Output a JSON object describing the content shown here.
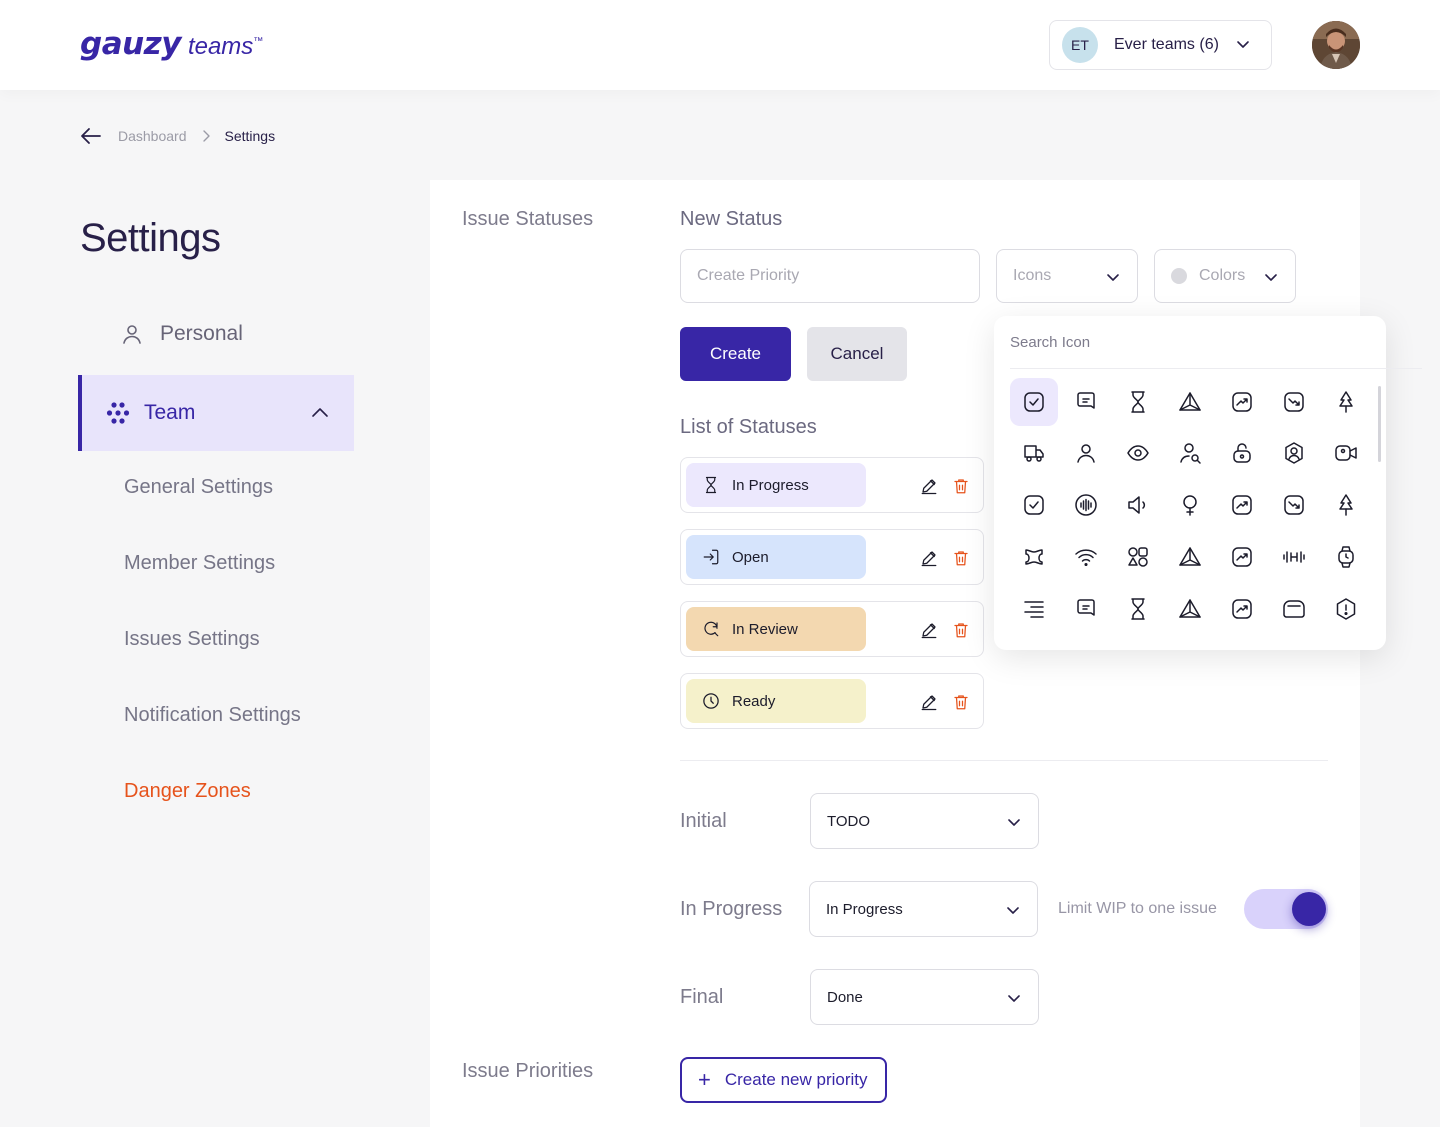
{
  "header": {
    "logo_brand": "gauzy",
    "logo_sub": "teams",
    "logo_tm": "™",
    "team_switcher": {
      "initials": "ET",
      "name": "Ever teams (6)"
    }
  },
  "breadcrumb": {
    "items": [
      "Dashboard",
      "Settings"
    ]
  },
  "sidebar": {
    "title": "Settings",
    "personal": "Personal",
    "team": "Team",
    "sub_items": [
      "General Settings",
      "Member Settings",
      "Issues Settings",
      "Notification Settings"
    ],
    "danger": "Danger Zones"
  },
  "issue_statuses": {
    "section_title": "Issue Statuses",
    "new_status_title": "New Status",
    "name_placeholder": "Create Priority",
    "icons_label": "Icons",
    "colors_label": "Colors",
    "create_button": "Create",
    "cancel_button": "Cancel",
    "list_title": "List of Statuses",
    "statuses": [
      {
        "label": "In Progress",
        "color": "#ece8fd",
        "icon": "hourglass-icon"
      },
      {
        "label": "Open",
        "color": "#d6e4fc",
        "icon": "login-icon"
      },
      {
        "label": "In Review",
        "color": "#f3d8b0",
        "icon": "search-refresh-icon"
      },
      {
        "label": "Ready",
        "color": "#f5f1cb",
        "icon": "clock-icon"
      }
    ]
  },
  "workflow": {
    "initial_label": "Initial",
    "initial_value": "TODO",
    "in_progress_label": "In Progress",
    "in_progress_value": "In Progress",
    "final_label": "Final",
    "final_value": "Done",
    "wip_label": "Limit WIP to one issue",
    "wip_enabled": true
  },
  "issue_priorities": {
    "section_title": "Issue Priorities",
    "create_button": "Create new priority"
  },
  "icon_picker": {
    "search_placeholder": "Search Icon",
    "selected_index": 0,
    "icons": [
      "task-square-icon",
      "message-square-icon",
      "hourglass-icon",
      "triangle-icon",
      "trend-up-icon",
      "trend-down-icon",
      "tree-icon",
      "truck-icon",
      "user-icon",
      "eye-icon",
      "user-search-icon",
      "unlock-icon",
      "user-hexagon-icon",
      "video-icon",
      "task-square-icon",
      "voice-circle-icon",
      "volume-icon",
      "woman-icon",
      "trend-up-icon",
      "trend-down-icon",
      "tree-icon",
      "weight-icon",
      "wifi-icon",
      "shapes-icon",
      "triangle-icon",
      "trend-up-icon",
      "dumbbell-icon",
      "watch-icon",
      "text-align-right-icon",
      "message-square-icon",
      "hourglass-icon",
      "triangle-icon",
      "trend-up-icon",
      "cloud-icon",
      "warning-icon"
    ]
  },
  "colors": {
    "accent": "#3826a6",
    "danger": "#e6531c",
    "delete": "#e6531c"
  }
}
